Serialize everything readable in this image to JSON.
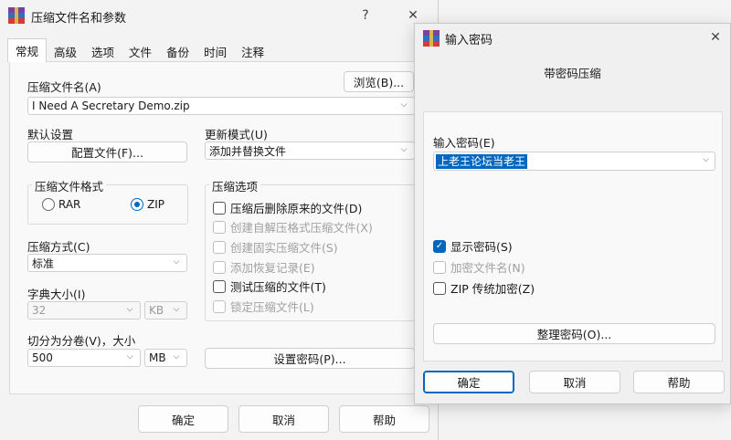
{
  "main_dialog": {
    "title": "压缩文件名和参数",
    "help_glyph": "?",
    "close_glyph": "✕",
    "tabs": [
      "常规",
      "高级",
      "选项",
      "文件",
      "备份",
      "时间",
      "注释"
    ],
    "archive_name_label": "压缩文件名(A)",
    "browse_button": "浏览(B)...",
    "archive_name_value": "I Need A Secretary Demo.zip",
    "default_settings_label": "默认设置",
    "profiles_button": "配置文件(F)...",
    "update_mode_label": "更新模式(U)",
    "update_mode_value": "添加并替换文件",
    "format_group_title": "压缩文件格式",
    "format_rar": "RAR",
    "format_zip": "ZIP",
    "options_group_title": "压缩选项",
    "options": [
      {
        "label": "压缩后删除原来的文件(D)",
        "checked": false,
        "disabled": false
      },
      {
        "label": "创建自解压格式压缩文件(X)",
        "checked": false,
        "disabled": true
      },
      {
        "label": "创建固实压缩文件(S)",
        "checked": false,
        "disabled": true
      },
      {
        "label": "添加恢复记录(E)",
        "checked": false,
        "disabled": true
      },
      {
        "label": "测试压缩的文件(T)",
        "checked": false,
        "disabled": false
      },
      {
        "label": "锁定压缩文件(L)",
        "checked": false,
        "disabled": true
      }
    ],
    "method_label": "压缩方式(C)",
    "method_value": "标准",
    "dict_label": "字典大小(I)",
    "dict_value": "32",
    "dict_unit": "KB",
    "split_label": "切分为分卷(V)，大小",
    "split_value": "500",
    "split_unit": "MB",
    "set_password_button": "设置密码(P)...",
    "ok_button": "确定",
    "cancel_button": "取消",
    "help_button": "帮助"
  },
  "password_dialog": {
    "title": "输入密码",
    "close_glyph": "✕",
    "subtitle": "带密码压缩",
    "password_label": "输入密码(E)",
    "password_value": "上老王论坛当老王",
    "show_password": "显示密码(S)",
    "encrypt_names": "加密文件名(N)",
    "zip_legacy": "ZIP 传统加密(Z)",
    "organize_button": "整理密码(O)...",
    "ok_button": "确定",
    "cancel_button": "取消",
    "help_button": "帮助",
    "checkmark_glyph": "✓"
  },
  "colors": {
    "accent": "#0067c0",
    "window_bg": "#f3f3f3"
  }
}
